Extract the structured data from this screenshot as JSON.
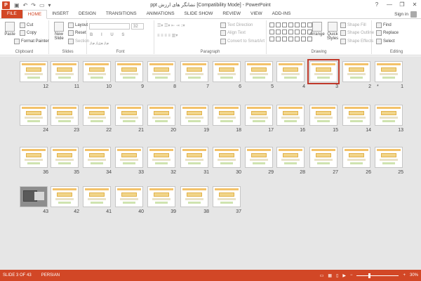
{
  "window": {
    "title": "ppt نشانگر های ارزش [Compatibility Mode] - PowerPoint",
    "app_icon": "P",
    "controls": [
      "?",
      "—",
      "❐",
      "✕"
    ]
  },
  "tabs": [
    "FILE",
    "HOME",
    "INSERT",
    "DESIGN",
    "TRANSITIONS",
    "ANIMATIONS",
    "SLIDE SHOW",
    "REVIEW",
    "VIEW",
    "ADD-INS"
  ],
  "active_tab": "HOME",
  "signin": "Sign in",
  "ribbon": {
    "clipboard": {
      "paste": "Paste",
      "cut": "Cut",
      "copy": "Copy",
      "format_painter": "Format Painter",
      "label": "Clipboard"
    },
    "slides": {
      "new_slide": "New Slide",
      "layout": "Layout",
      "reset": "Reset",
      "section": "Section",
      "label": "Slides"
    },
    "font": {
      "size": "32",
      "label": "Font"
    },
    "paragraph": {
      "text_direction": "Text Direction",
      "align_text": "Align Text",
      "convert_smartart": "Convert to SmartArt",
      "label": "Paragraph"
    },
    "drawing": {
      "arrange": "Arrange",
      "quick_styles": "Quick Styles",
      "shape_fill": "Shape Fill",
      "shape_outline": "Shape Outline",
      "shape_effects": "Shape Effects",
      "label": "Drawing"
    },
    "editing": {
      "find": "Find",
      "replace": "Replace",
      "select": "Select",
      "label": "Editing"
    }
  },
  "slides": {
    "numbers": [
      "12",
      "11",
      "10",
      "9",
      "8",
      "7",
      "6",
      "5",
      "4",
      "3",
      "2",
      "1",
      "24",
      "23",
      "22",
      "21",
      "20",
      "19",
      "18",
      "17",
      "16",
      "15",
      "14",
      "13",
      "36",
      "35",
      "34",
      "33",
      "32",
      "31",
      "30",
      "29",
      "28",
      "27",
      "26",
      "25",
      "43",
      "42",
      "41",
      "40",
      "39",
      "38",
      "37"
    ],
    "selected": "3",
    "marker": "*"
  },
  "status": {
    "slide_info": "SLIDE 3 OF 43",
    "language": "PERSIAN",
    "zoom": "30%",
    "zoom_level": 0.3
  },
  "colors": {
    "accent": "#d24726",
    "selection": "#c0392b"
  }
}
